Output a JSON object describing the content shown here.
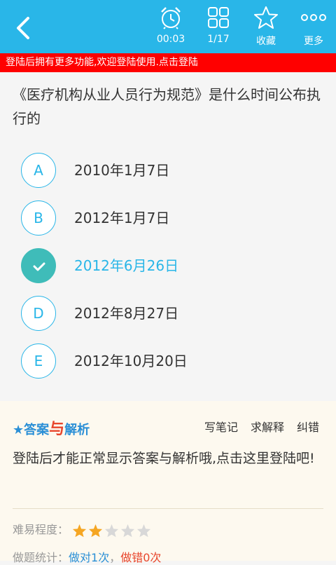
{
  "header": {
    "timer_value": "00:03",
    "progress": "1/17",
    "favorite_label": "收藏",
    "more_label": "更多"
  },
  "banner": {
    "text": "登陆后拥有更多功能,欢迎登陆使用.点击登陆"
  },
  "question": {
    "text": "《医疗机构从业人员行为规范》是什么时间公布执行的"
  },
  "options": [
    {
      "letter": "A",
      "text": "2010年1月7日",
      "selected": false
    },
    {
      "letter": "B",
      "text": "2012年1月7日",
      "selected": false
    },
    {
      "letter": "C",
      "text": "2012年6月26日",
      "selected": true
    },
    {
      "letter": "D",
      "text": "2012年8月27日",
      "selected": false
    },
    {
      "letter": "E",
      "text": "2012年10月20日",
      "selected": false
    }
  ],
  "answer_section": {
    "title_part1": "答案",
    "title_connector": "与",
    "title_part2": "解析",
    "write_note": "写笔记",
    "ask_explain": "求解释",
    "report_error": "纠错",
    "login_prompt": "登陆后才能正常显示答案与解析哦,点击这里登陆吧!",
    "difficulty_label": "难易程度：",
    "difficulty_rating": 2,
    "difficulty_max": 5,
    "stats_label": "做题统计：",
    "correct_text": "做对1次",
    "separator": "，",
    "wrong_text": "做错0次"
  },
  "colors": {
    "accent": "#29b6e8",
    "selected": "#3fbcb9",
    "banner": "#ff0000",
    "star_filled": "#f5a623",
    "star_empty": "#d8d8d8"
  }
}
